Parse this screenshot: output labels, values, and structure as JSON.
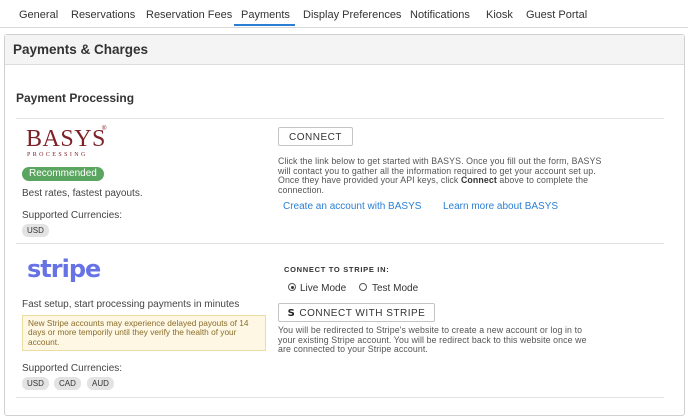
{
  "tabs": [
    {
      "label": "General"
    },
    {
      "label": "Reservations"
    },
    {
      "label": "Reservation Fees"
    },
    {
      "label": "Payments"
    },
    {
      "label": "Display Preferences"
    },
    {
      "label": "Notifications"
    },
    {
      "label": "Kiosk"
    },
    {
      "label": "Guest Portal"
    }
  ],
  "active_tab": "Payments",
  "card_title": "Payments & Charges",
  "section_title": "Payment Processing",
  "basys": {
    "logo_text": "BASYS",
    "logo_reg": "®",
    "logo_sub": "PROCESSING",
    "badge": "Recommended",
    "tagline": "Best rates, fastest payouts.",
    "currencies_label": "Supported Currencies:",
    "currencies": [
      "USD"
    ],
    "connect_label": "CONNECT",
    "description_1": "Click the link below to get started with BASYS. Once you fill out the form, BASYS",
    "description_2": "will contact you to gather all the information required to get your account set up.",
    "description_3a": "Once they have provided your API keys, click ",
    "description_3b": "Connect",
    "description_3c": " above to complete the",
    "description_4": "connection.",
    "link_create": "Create an account with BASYS",
    "link_learn": "Learn more about BASYS"
  },
  "stripe": {
    "logo_text": "stripe",
    "tagline": "Fast setup, start processing payments in minutes",
    "warning": "New Stripe accounts may experience delayed payouts of 14 days or more temporily until they verify the health of your account.",
    "currencies_label": "Supported Currencies:",
    "currencies": [
      "USD",
      "CAD",
      "AUD"
    ],
    "connect_in_label": "CONNECT TO STRIPE IN:",
    "modes": [
      {
        "label": "Live Mode",
        "checked": true
      },
      {
        "label": "Test Mode",
        "checked": false
      }
    ],
    "button_icon": "S",
    "button_label": "CONNECT WITH STRIPE",
    "redirect_1": "You will be redirected to Stripe's website to create a new account or log in to",
    "redirect_2": "your existing Stripe account. You will be redirect back to this website once we",
    "redirect_3": "are connected to your Stripe account."
  },
  "colors": {
    "accent": "#2a7fd4",
    "recommended": "#5aa55f",
    "basys_brand": "#7d2228",
    "stripe_brand": "#6772e5",
    "warning_bg": "#fdf7e3"
  }
}
